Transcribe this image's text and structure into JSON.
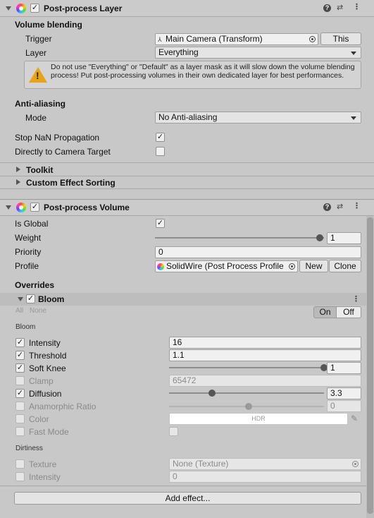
{
  "layer_component": {
    "title": "Post-process Layer",
    "volume_blending": {
      "heading": "Volume blending",
      "trigger_label": "Trigger",
      "trigger_value": "Main Camera (Transform)",
      "this_button": "This",
      "layer_label": "Layer",
      "layer_value": "Everything",
      "warning": "Do not use \"Everything\" or \"Default\" as a layer mask as it will slow down the volume blending process! Put post-processing volumes in their own dedicated layer for best performances."
    },
    "anti_aliasing": {
      "heading": "Anti-aliasing",
      "mode_label": "Mode",
      "mode_value": "No Anti-aliasing"
    },
    "stop_nan_label": "Stop NaN Propagation",
    "stop_nan_checked": true,
    "direct_to_camera_label": "Directly to Camera Target",
    "direct_to_camera_checked": false,
    "toolkit_label": "Toolkit",
    "custom_sorting_label": "Custom Effect Sorting"
  },
  "volume_component": {
    "title": "Post-process Volume",
    "is_global_label": "Is Global",
    "is_global_checked": true,
    "weight_label": "Weight",
    "weight_value": "1",
    "weight_fraction": 1.0,
    "priority_label": "Priority",
    "priority_value": "0",
    "profile_label": "Profile",
    "profile_value": "SolidWire (Post Process Profile",
    "new_button": "New",
    "clone_button": "Clone",
    "overrides_heading": "Overrides",
    "bloom": {
      "title": "Bloom",
      "all_label": "All",
      "none_label": "None",
      "on_label": "On",
      "off_label": "Off",
      "section_label": "Bloom",
      "intensity_label": "Intensity",
      "intensity_value": "16",
      "threshold_label": "Threshold",
      "threshold_value": "1.1",
      "soft_knee_label": "Soft Knee",
      "soft_knee_value": "1",
      "soft_knee_fraction": 1.0,
      "clamp_label": "Clamp",
      "clamp_value": "65472",
      "diffusion_label": "Diffusion",
      "diffusion_value": "3.3",
      "diffusion_fraction": 0.26,
      "anamorphic_label": "Anamorphic Ratio",
      "anamorphic_value": "0",
      "anamorphic_fraction": 0.5,
      "color_label": "Color",
      "color_hdr": "HDR",
      "fast_mode_label": "Fast Mode",
      "dirtiness_label": "Dirtiness",
      "texture_label": "Texture",
      "texture_value": "None (Texture)",
      "dirt_intensity_label": "Intensity",
      "dirt_intensity_value": "0"
    },
    "add_effect_button": "Add effect..."
  }
}
